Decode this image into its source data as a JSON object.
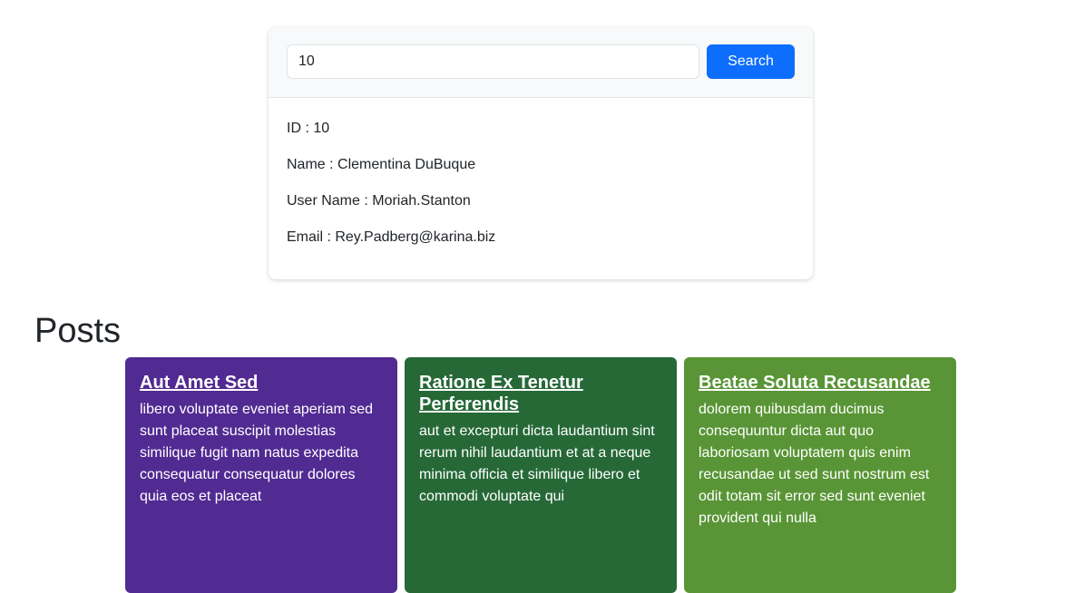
{
  "search": {
    "value": "10",
    "button_label": "Search"
  },
  "user": {
    "id": "ID : 10",
    "name": "Name : Clementina DuBuque",
    "username": "User Name : Moriah.Stanton",
    "email": "Email : Rey.Padberg@karina.biz"
  },
  "posts": {
    "heading": "Posts",
    "items": [
      {
        "title": "Aut Amet Sed",
        "body": "libero voluptate eveniet aperiam sed sunt placeat suscipit molestias similique fugit nam natus expedita consequatur consequatur dolores quia eos et placeat",
        "color": "#512a92"
      },
      {
        "title": "Ratione Ex Tenetur Perferendis",
        "body": "aut et excepturi dicta laudantium sint rerum nihil laudantium et at a neque minima officia et similique libero et commodi voluptate qui",
        "color": "#266937"
      },
      {
        "title": "Beatae Soluta Recusandae",
        "body": "dolorem quibusdam ducimus consequuntur dicta aut quo laboriosam voluptatem quis enim recusandae ut sed sunt nostrum est odit totam sit error sed sunt eveniet provident qui nulla",
        "color": "#599536"
      }
    ]
  },
  "colors": {
    "primary": "#0d6efd"
  }
}
